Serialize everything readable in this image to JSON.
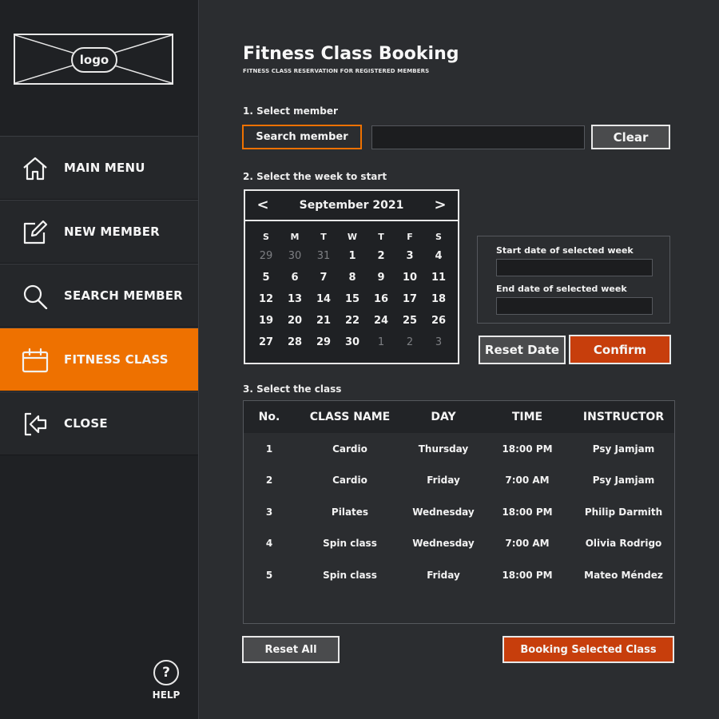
{
  "sidebar": {
    "logo": "logo",
    "nav": [
      {
        "label": "MAIN MENU",
        "icon": "home-icon"
      },
      {
        "label": "NEW MEMBER",
        "icon": "edit-icon"
      },
      {
        "label": "SEARCH MEMBER",
        "icon": "search-icon"
      },
      {
        "label": "FITNESS CLASS",
        "icon": "calendar-icon",
        "active": true
      },
      {
        "label": "CLOSE",
        "icon": "logout-icon"
      }
    ],
    "help": {
      "icon": "?",
      "label": "HELP"
    }
  },
  "header": {
    "title": "Fitness Class Booking",
    "subtitle": "FITNESS CLASS RESERVATION FOR  REGISTERED MEMBERS"
  },
  "step1": {
    "label": "1. Select member",
    "search_button": "Search member",
    "member_value": "",
    "clear_button": "Clear"
  },
  "step2": {
    "label": "2. Select the week to start",
    "calendar": {
      "month": "September 2021",
      "prev": "<",
      "next": ">",
      "weekdays": [
        "S",
        "M",
        "T",
        "W",
        "T",
        "F",
        "S"
      ],
      "weeks": [
        [
          {
            "d": "29",
            "m": true
          },
          {
            "d": "30",
            "m": true
          },
          {
            "d": "31",
            "m": true
          },
          {
            "d": "1"
          },
          {
            "d": "2"
          },
          {
            "d": "3"
          },
          {
            "d": "4"
          }
        ],
        [
          {
            "d": "5"
          },
          {
            "d": "6"
          },
          {
            "d": "7"
          },
          {
            "d": "8"
          },
          {
            "d": "9"
          },
          {
            "d": "10"
          },
          {
            "d": "11"
          }
        ],
        [
          {
            "d": "12"
          },
          {
            "d": "13"
          },
          {
            "d": "14"
          },
          {
            "d": "15"
          },
          {
            "d": "16"
          },
          {
            "d": "17"
          },
          {
            "d": "18"
          }
        ],
        [
          {
            "d": "19"
          },
          {
            "d": "20"
          },
          {
            "d": "21"
          },
          {
            "d": "22"
          },
          {
            "d": "24"
          },
          {
            "d": "25"
          },
          {
            "d": "26"
          }
        ],
        [
          {
            "d": "27"
          },
          {
            "d": "28"
          },
          {
            "d": "29"
          },
          {
            "d": "30"
          },
          {
            "d": "1",
            "m": true
          },
          {
            "d": "2",
            "m": true
          },
          {
            "d": "3",
            "m": true
          }
        ]
      ]
    },
    "start_date_label": "Start date of selected week",
    "start_date_value": "",
    "end_date_label": "End date of selected week",
    "end_date_value": "",
    "reset_date_button": "Reset Date",
    "confirm_button": "Confirm"
  },
  "step3": {
    "label": "3. Select the class",
    "columns": [
      "No.",
      "CLASS NAME",
      "DAY",
      "TIME",
      "INSTRUCTOR"
    ],
    "rows": [
      [
        "1",
        "Cardio",
        "Thursday",
        "18:00 PM",
        "Psy  Jamjam"
      ],
      [
        "2",
        "Cardio",
        "Friday",
        "7:00 AM",
        "Psy  Jamjam"
      ],
      [
        "3",
        "Pilates",
        "Wednesday",
        "18:00 PM",
        "Philip  Darmith"
      ],
      [
        "4",
        "Spin class",
        "Wednesday",
        "7:00 AM",
        "Olivia Rodrigo"
      ],
      [
        "5",
        "Spin class",
        "Friday",
        "18:00 PM",
        "Mateo Méndez"
      ]
    ]
  },
  "footer": {
    "reset_all_button": "Reset All",
    "book_button": "Booking Selected Class"
  },
  "colors": {
    "accent": "#ee7100",
    "confirm": "#c73e0c",
    "background": "#2b2d30",
    "sidebar": "#1f2124"
  }
}
